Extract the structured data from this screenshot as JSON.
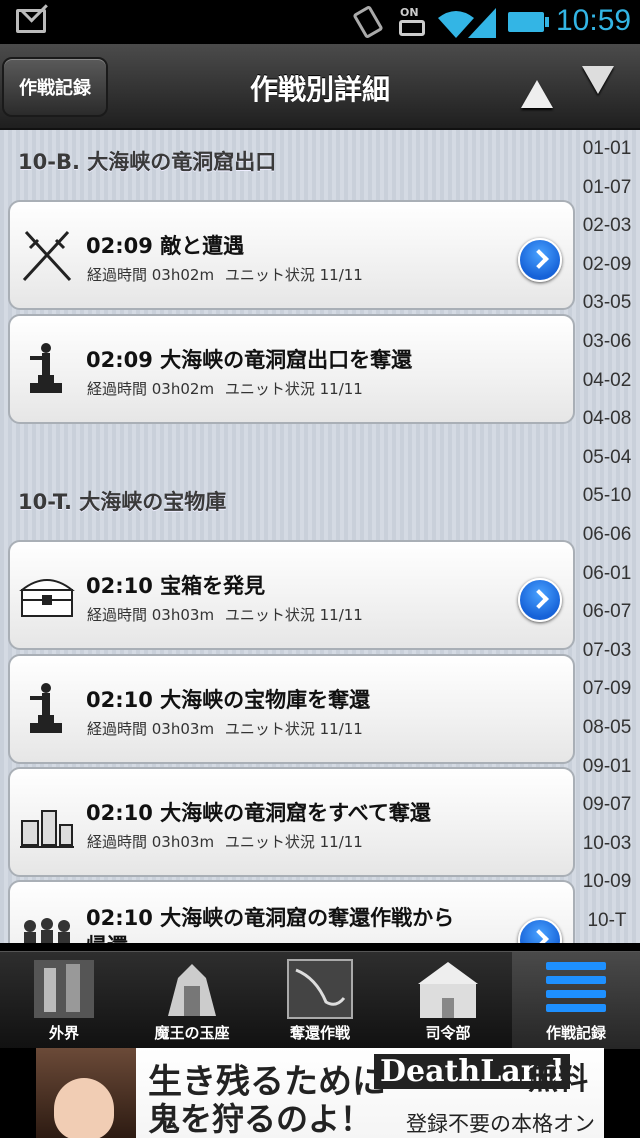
{
  "status_bar": {
    "on_label": "ON",
    "time": "10:59"
  },
  "header": {
    "back_label": "作戦記録",
    "title": "作戦別詳細"
  },
  "sections": [
    {
      "title": "10-B. 大海峡の竜洞窟出口",
      "items": [
        {
          "icon": "crossed-swords-icon",
          "title": "02:09 敵と遭遇",
          "elapsed": "経過時間 03h02m",
          "unit_status": "ユニット状況 11/11",
          "has_detail": true
        },
        {
          "icon": "statue-icon",
          "title": "02:09 大海峡の竜洞窟出口を奪還",
          "elapsed": "経過時間 03h02m",
          "unit_status": "ユニット状況 11/11",
          "has_detail": false
        }
      ]
    },
    {
      "title": "10-T. 大海峡の宝物庫",
      "items": [
        {
          "icon": "treasure-chest-icon",
          "title": "02:10 宝箱を発見",
          "elapsed": "経過時間 03h03m",
          "unit_status": "ユニット状況 11/11",
          "has_detail": true
        },
        {
          "icon": "statue-icon",
          "title": "02:10 大海峡の宝物庫を奪還",
          "elapsed": "経過時間 03h03m",
          "unit_status": "ユニット状況 11/11",
          "has_detail": false
        },
        {
          "icon": "ruins-icon",
          "title": "02:10 大海峡の竜洞窟をすべて奪還",
          "elapsed": "経過時間 03h03m",
          "unit_status": "ユニット状況 11/11",
          "has_detail": false
        },
        {
          "icon": "soldiers-icon",
          "title": "02:10 大海峡の竜洞窟の奪還作戦から",
          "title_line2": "帰還",
          "has_detail": true
        }
      ]
    }
  ],
  "index": [
    "01-01",
    "01-07",
    "02-03",
    "02-09",
    "03-05",
    "03-06",
    "04-02",
    "04-08",
    "05-04",
    "05-10",
    "06-06",
    "06-01",
    "06-07",
    "07-03",
    "07-09",
    "08-05",
    "09-01",
    "09-07",
    "10-03",
    "10-09",
    "10-T"
  ],
  "tabs": [
    {
      "label": "外界",
      "icon": "outer-world-icon",
      "active": false
    },
    {
      "label": "魔王の玉座",
      "icon": "throne-icon",
      "active": false
    },
    {
      "label": "奪還作戦",
      "icon": "map-icon",
      "active": false
    },
    {
      "label": "司令部",
      "icon": "headquarters-icon",
      "active": false
    },
    {
      "label": "作戦記録",
      "icon": "records-icon",
      "active": true
    }
  ],
  "ad": {
    "line1": "生き残るために",
    "line2": "鬼を狩るのよ！",
    "brand": "DeathLand",
    "free": "無料",
    "sub": "登録不要の本格オンラインRPG"
  },
  "colors": {
    "accent": "#33b5e5",
    "detail_button": "#1662d8"
  }
}
